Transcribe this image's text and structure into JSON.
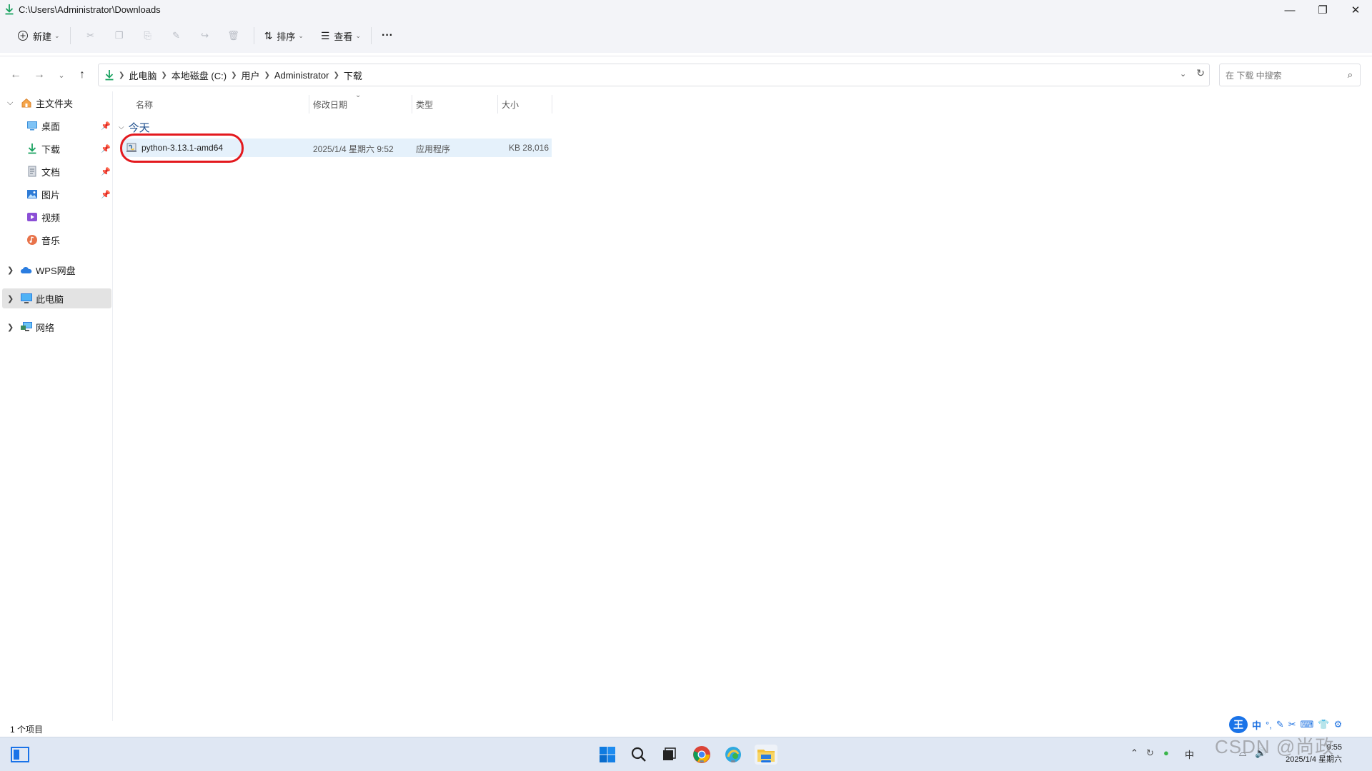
{
  "window": {
    "title": "C:\\Users\\Administrator\\Downloads",
    "controls": [
      "minimize",
      "restore",
      "close"
    ]
  },
  "toolbar": {
    "new_label": "新建",
    "sort_label": "排序",
    "view_label": "查看",
    "more_label": "···",
    "disabled_actions": [
      "cut-icon",
      "copy-icon",
      "paste-icon",
      "rename-icon",
      "share-icon",
      "delete-icon"
    ]
  },
  "address": {
    "crumbs": [
      "此电脑",
      "本地磁盘 (C:)",
      "用户",
      "Administrator",
      "下载"
    ]
  },
  "search": {
    "placeholder": "在 下载 中搜索"
  },
  "sidebar": {
    "home_label": "主文件夹",
    "quick_items": [
      {
        "label": "桌面",
        "icon": "desktop-icon",
        "pinned": true
      },
      {
        "label": "下载",
        "icon": "download-icon",
        "pinned": true
      },
      {
        "label": "文档",
        "icon": "document-icon",
        "pinned": true
      },
      {
        "label": "图片",
        "icon": "pictures-icon",
        "pinned": true
      },
      {
        "label": "视频",
        "icon": "video-icon",
        "pinned": false
      },
      {
        "label": "音乐",
        "icon": "music-icon",
        "pinned": false
      }
    ],
    "wps_label": "WPS网盘",
    "thispc_label": "此电脑",
    "network_label": "网络"
  },
  "columns": {
    "name": "名称",
    "date": "修改日期",
    "type": "类型",
    "size": "大小"
  },
  "group": {
    "label": "今天"
  },
  "files": [
    {
      "name": "python-3.13.1-amd64",
      "date": "2025/1/4 星期六 9:52",
      "type": "应用程序",
      "size": "28,016 KB"
    }
  ],
  "status": {
    "count": "1 个项目"
  },
  "ime": {
    "lang": "中",
    "items": [
      "°,",
      "✎",
      "✂",
      "⌨",
      "👕",
      "⚙"
    ]
  },
  "taskbar": {
    "tray_lang": "中",
    "time": "9:55",
    "date": "2025/1/4 星期六"
  },
  "watermark": "CSDN @尚政",
  "colors": {
    "accent": "#1a73e8",
    "selection": "#e5f1fb",
    "highlight_ring": "#e3191e",
    "group_text": "#1e4e8c"
  }
}
